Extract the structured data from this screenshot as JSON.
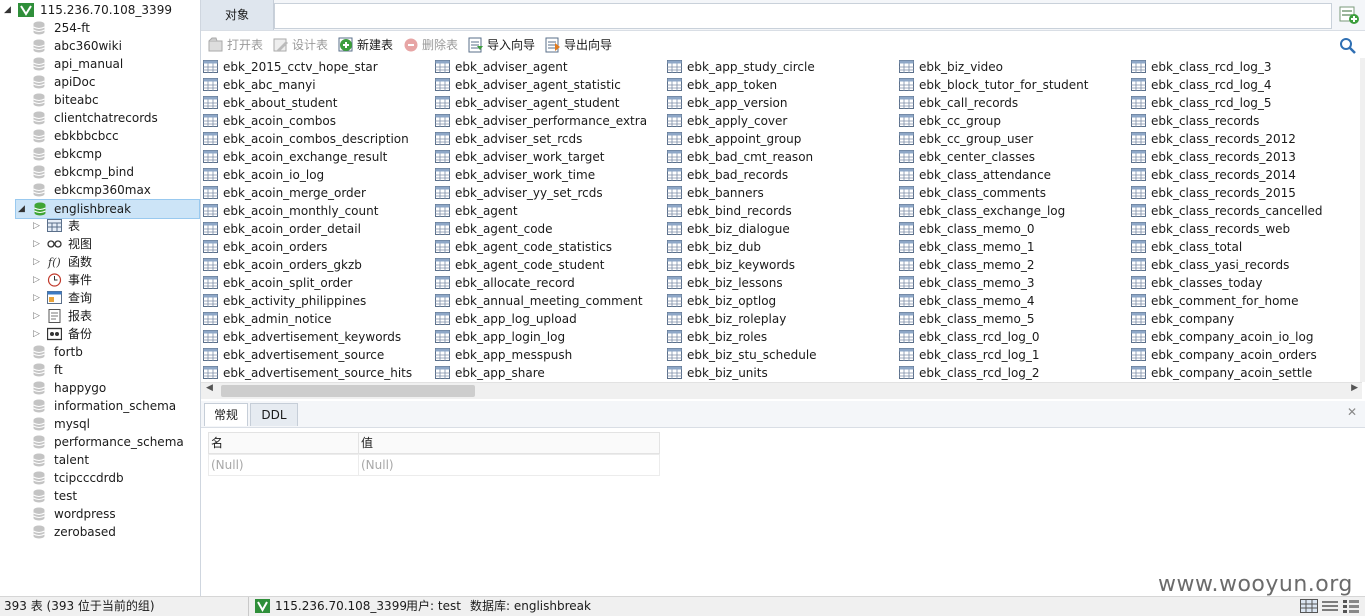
{
  "connection": "115.236.70.108_3399",
  "databases_before": [
    "254-ft",
    "abc360wiki",
    "api_manual",
    "apiDoc",
    "biteabc",
    "clientchatrecords",
    "ebkbbcbcc",
    "ebkcmp",
    "ebkcmp_bind",
    "ebkcmp360max"
  ],
  "active_db": "englishbreak",
  "db_children": [
    {
      "label": "表",
      "icon": "table-icon"
    },
    {
      "label": "视图",
      "icon": "view-icon"
    },
    {
      "label": "函数",
      "icon": "function-icon"
    },
    {
      "label": "事件",
      "icon": "event-icon"
    },
    {
      "label": "查询",
      "icon": "query-icon"
    },
    {
      "label": "报表",
      "icon": "report-icon"
    },
    {
      "label": "备份",
      "icon": "backup-icon"
    }
  ],
  "databases_after": [
    "fortb",
    "ft",
    "happygo",
    "information_schema",
    "mysql",
    "performance_schema",
    "talent",
    "tcipcccdrdb",
    "test",
    "wordpress",
    "zerobased"
  ],
  "main_tab": "对象",
  "toolbar": [
    {
      "label": "打开表",
      "enabled": false,
      "icon": "open-table-icon"
    },
    {
      "label": "设计表",
      "enabled": false,
      "icon": "design-table-icon"
    },
    {
      "label": "新建表",
      "enabled": true,
      "icon": "new-table-icon"
    },
    {
      "label": "删除表",
      "enabled": false,
      "icon": "delete-table-icon"
    },
    {
      "label": "导入向导",
      "enabled": true,
      "icon": "import-wizard-icon"
    },
    {
      "label": "导出向导",
      "enabled": true,
      "icon": "export-wizard-icon"
    }
  ],
  "tables": [
    [
      "ebk_2015_cctv_hope_star",
      "ebk_abc_manyi",
      "ebk_about_student",
      "ebk_acoin_combos",
      "ebk_acoin_combos_description",
      "ebk_acoin_exchange_result",
      "ebk_acoin_io_log",
      "ebk_acoin_merge_order",
      "ebk_acoin_monthly_count",
      "ebk_acoin_order_detail",
      "ebk_acoin_orders",
      "ebk_acoin_orders_gkzb",
      "ebk_acoin_split_order",
      "ebk_activity_philippines",
      "ebk_admin_notice",
      "ebk_advertisement_keywords",
      "ebk_advertisement_source",
      "ebk_advertisement_source_hits"
    ],
    [
      "ebk_adviser_agent",
      "ebk_adviser_agent_statistic",
      "ebk_adviser_agent_student",
      "ebk_adviser_performance_extra",
      "ebk_adviser_set_rcds",
      "ebk_adviser_work_target",
      "ebk_adviser_work_time",
      "ebk_adviser_yy_set_rcds",
      "ebk_agent",
      "ebk_agent_code",
      "ebk_agent_code_statistics",
      "ebk_agent_code_student",
      "ebk_allocate_record",
      "ebk_annual_meeting_comment",
      "ebk_app_log_upload",
      "ebk_app_login_log",
      "ebk_app_messpush",
      "ebk_app_share"
    ],
    [
      "ebk_app_study_circle",
      "ebk_app_token",
      "ebk_app_version",
      "ebk_apply_cover",
      "ebk_appoint_group",
      "ebk_bad_cmt_reason",
      "ebk_bad_records",
      "ebk_banners",
      "ebk_bind_records",
      "ebk_biz_dialogue",
      "ebk_biz_dub",
      "ebk_biz_keywords",
      "ebk_biz_lessons",
      "ebk_biz_optlog",
      "ebk_biz_roleplay",
      "ebk_biz_roles",
      "ebk_biz_stu_schedule",
      "ebk_biz_units"
    ],
    [
      "ebk_biz_video",
      "ebk_block_tutor_for_student",
      "ebk_call_records",
      "ebk_cc_group",
      "ebk_cc_group_user",
      "ebk_center_classes",
      "ebk_class_attendance",
      "ebk_class_comments",
      "ebk_class_exchange_log",
      "ebk_class_memo_0",
      "ebk_class_memo_1",
      "ebk_class_memo_2",
      "ebk_class_memo_3",
      "ebk_class_memo_4",
      "ebk_class_memo_5",
      "ebk_class_rcd_log_0",
      "ebk_class_rcd_log_1",
      "ebk_class_rcd_log_2"
    ],
    [
      "ebk_class_rcd_log_3",
      "ebk_class_rcd_log_4",
      "ebk_class_rcd_log_5",
      "ebk_class_records",
      "ebk_class_records_2012",
      "ebk_class_records_2013",
      "ebk_class_records_2014",
      "ebk_class_records_2015",
      "ebk_class_records_cancelled",
      "ebk_class_records_web",
      "ebk_class_total",
      "ebk_class_yasi_records",
      "ebk_classes_today",
      "ebk_comment_for_home",
      "ebk_company",
      "ebk_company_acoin_io_log",
      "ebk_company_acoin_orders",
      "ebk_company_acoin_settle"
    ]
  ],
  "bottom_tabs": [
    "常规",
    "DDL"
  ],
  "props": {
    "name_header": "名",
    "value_header": "值",
    "name_val": "(Null)",
    "value_val": "(Null)"
  },
  "status": {
    "count": "393 表 (393 位于当前的组)",
    "conn": "115.236.70.108_3399",
    "user": "用户: test",
    "db": "数据库: englishbreak"
  },
  "watermark": "www.wooyun.org",
  "colors": {
    "selection": "#cce4f7",
    "tab_active": "#dfe6ee",
    "db_icon": "#c4c4c4",
    "active_db_icon": "#3fa535"
  }
}
